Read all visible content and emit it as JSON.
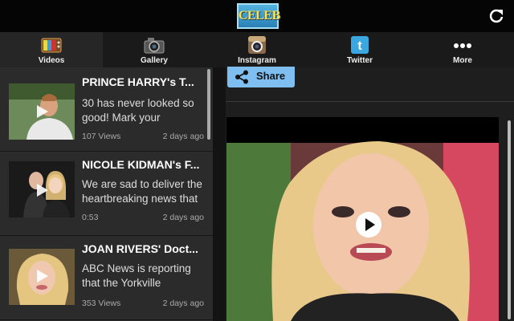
{
  "header": {
    "logo_text": "CELEB TV"
  },
  "tabs": [
    {
      "label": "Videos",
      "icon": "tv-icon"
    },
    {
      "label": "Gallery",
      "icon": "camera-icon"
    },
    {
      "label": "Instagram",
      "icon": "instagram-icon"
    },
    {
      "label": "Twitter",
      "icon": "twitter-icon"
    },
    {
      "label": "More",
      "icon": "more-dots-icon"
    }
  ],
  "videos": [
    {
      "title": "PRINCE HARRY's T...",
      "desc_line1": "30 has never looked so",
      "desc_line2": "good! Mark your",
      "stat": "107 Views",
      "age": "2 days ago"
    },
    {
      "title": "NICOLE KIDMAN's F...",
      "desc_line1": "We are sad to deliver the",
      "desc_line2": "heartbreaking news that",
      "stat": "0:53",
      "age": "2 days ago"
    },
    {
      "title": "JOAN RIVERS' Doct...",
      "desc_line1": "ABC News is reporting",
      "desc_line2": "that the Yorkville",
      "stat": "353 Views",
      "age": "2 days ago"
    }
  ],
  "share": {
    "label": "Share"
  },
  "colors": {
    "share_bg": "#7fbef0",
    "logo_text": "#ffe24b",
    "logo_bg": "#2a7fb5"
  }
}
